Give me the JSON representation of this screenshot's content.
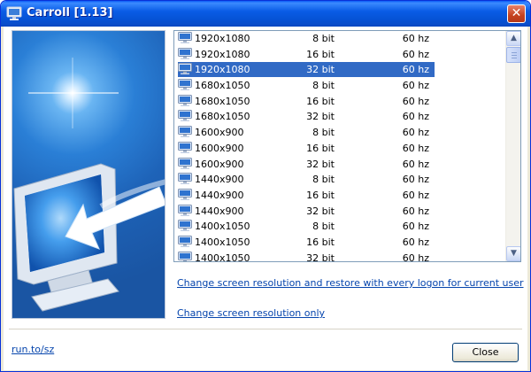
{
  "window": {
    "title": "Carroll [1.13]",
    "accent_color": "#0a5ce6",
    "close_icon": "close-x-icon"
  },
  "resolutions": [
    {
      "res": "1920x1080",
      "bits": "8 bit",
      "hz": "60 hz"
    },
    {
      "res": "1920x1080",
      "bits": "16 bit",
      "hz": "60 hz"
    },
    {
      "res": "1920x1080",
      "bits": "32 bit",
      "hz": "60 hz",
      "selected": true
    },
    {
      "res": "1680x1050",
      "bits": "8 bit",
      "hz": "60 hz"
    },
    {
      "res": "1680x1050",
      "bits": "16 bit",
      "hz": "60 hz"
    },
    {
      "res": "1680x1050",
      "bits": "32 bit",
      "hz": "60 hz"
    },
    {
      "res": "1600x900",
      "bits": "8 bit",
      "hz": "60 hz"
    },
    {
      "res": "1600x900",
      "bits": "16 bit",
      "hz": "60 hz"
    },
    {
      "res": "1600x900",
      "bits": "32 bit",
      "hz": "60 hz"
    },
    {
      "res": "1440x900",
      "bits": "8 bit",
      "hz": "60 hz"
    },
    {
      "res": "1440x900",
      "bits": "16 bit",
      "hz": "60 hz"
    },
    {
      "res": "1440x900",
      "bits": "32 bit",
      "hz": "60 hz"
    },
    {
      "res": "1400x1050",
      "bits": "8 bit",
      "hz": "60 hz"
    },
    {
      "res": "1400x1050",
      "bits": "16 bit",
      "hz": "60 hz"
    },
    {
      "res": "1400x1050",
      "bits": "32 bit",
      "hz": "60 hz"
    }
  ],
  "links": {
    "change_and_restore": "Change screen resolution and restore with every logon for current user",
    "change_only": "Change screen resolution only"
  },
  "footer": {
    "site_link": "run.to/sz",
    "close_label": "Close"
  },
  "icons": {
    "list_row": "monitor-icon",
    "side_art": "monitor-arrow-illustration"
  }
}
